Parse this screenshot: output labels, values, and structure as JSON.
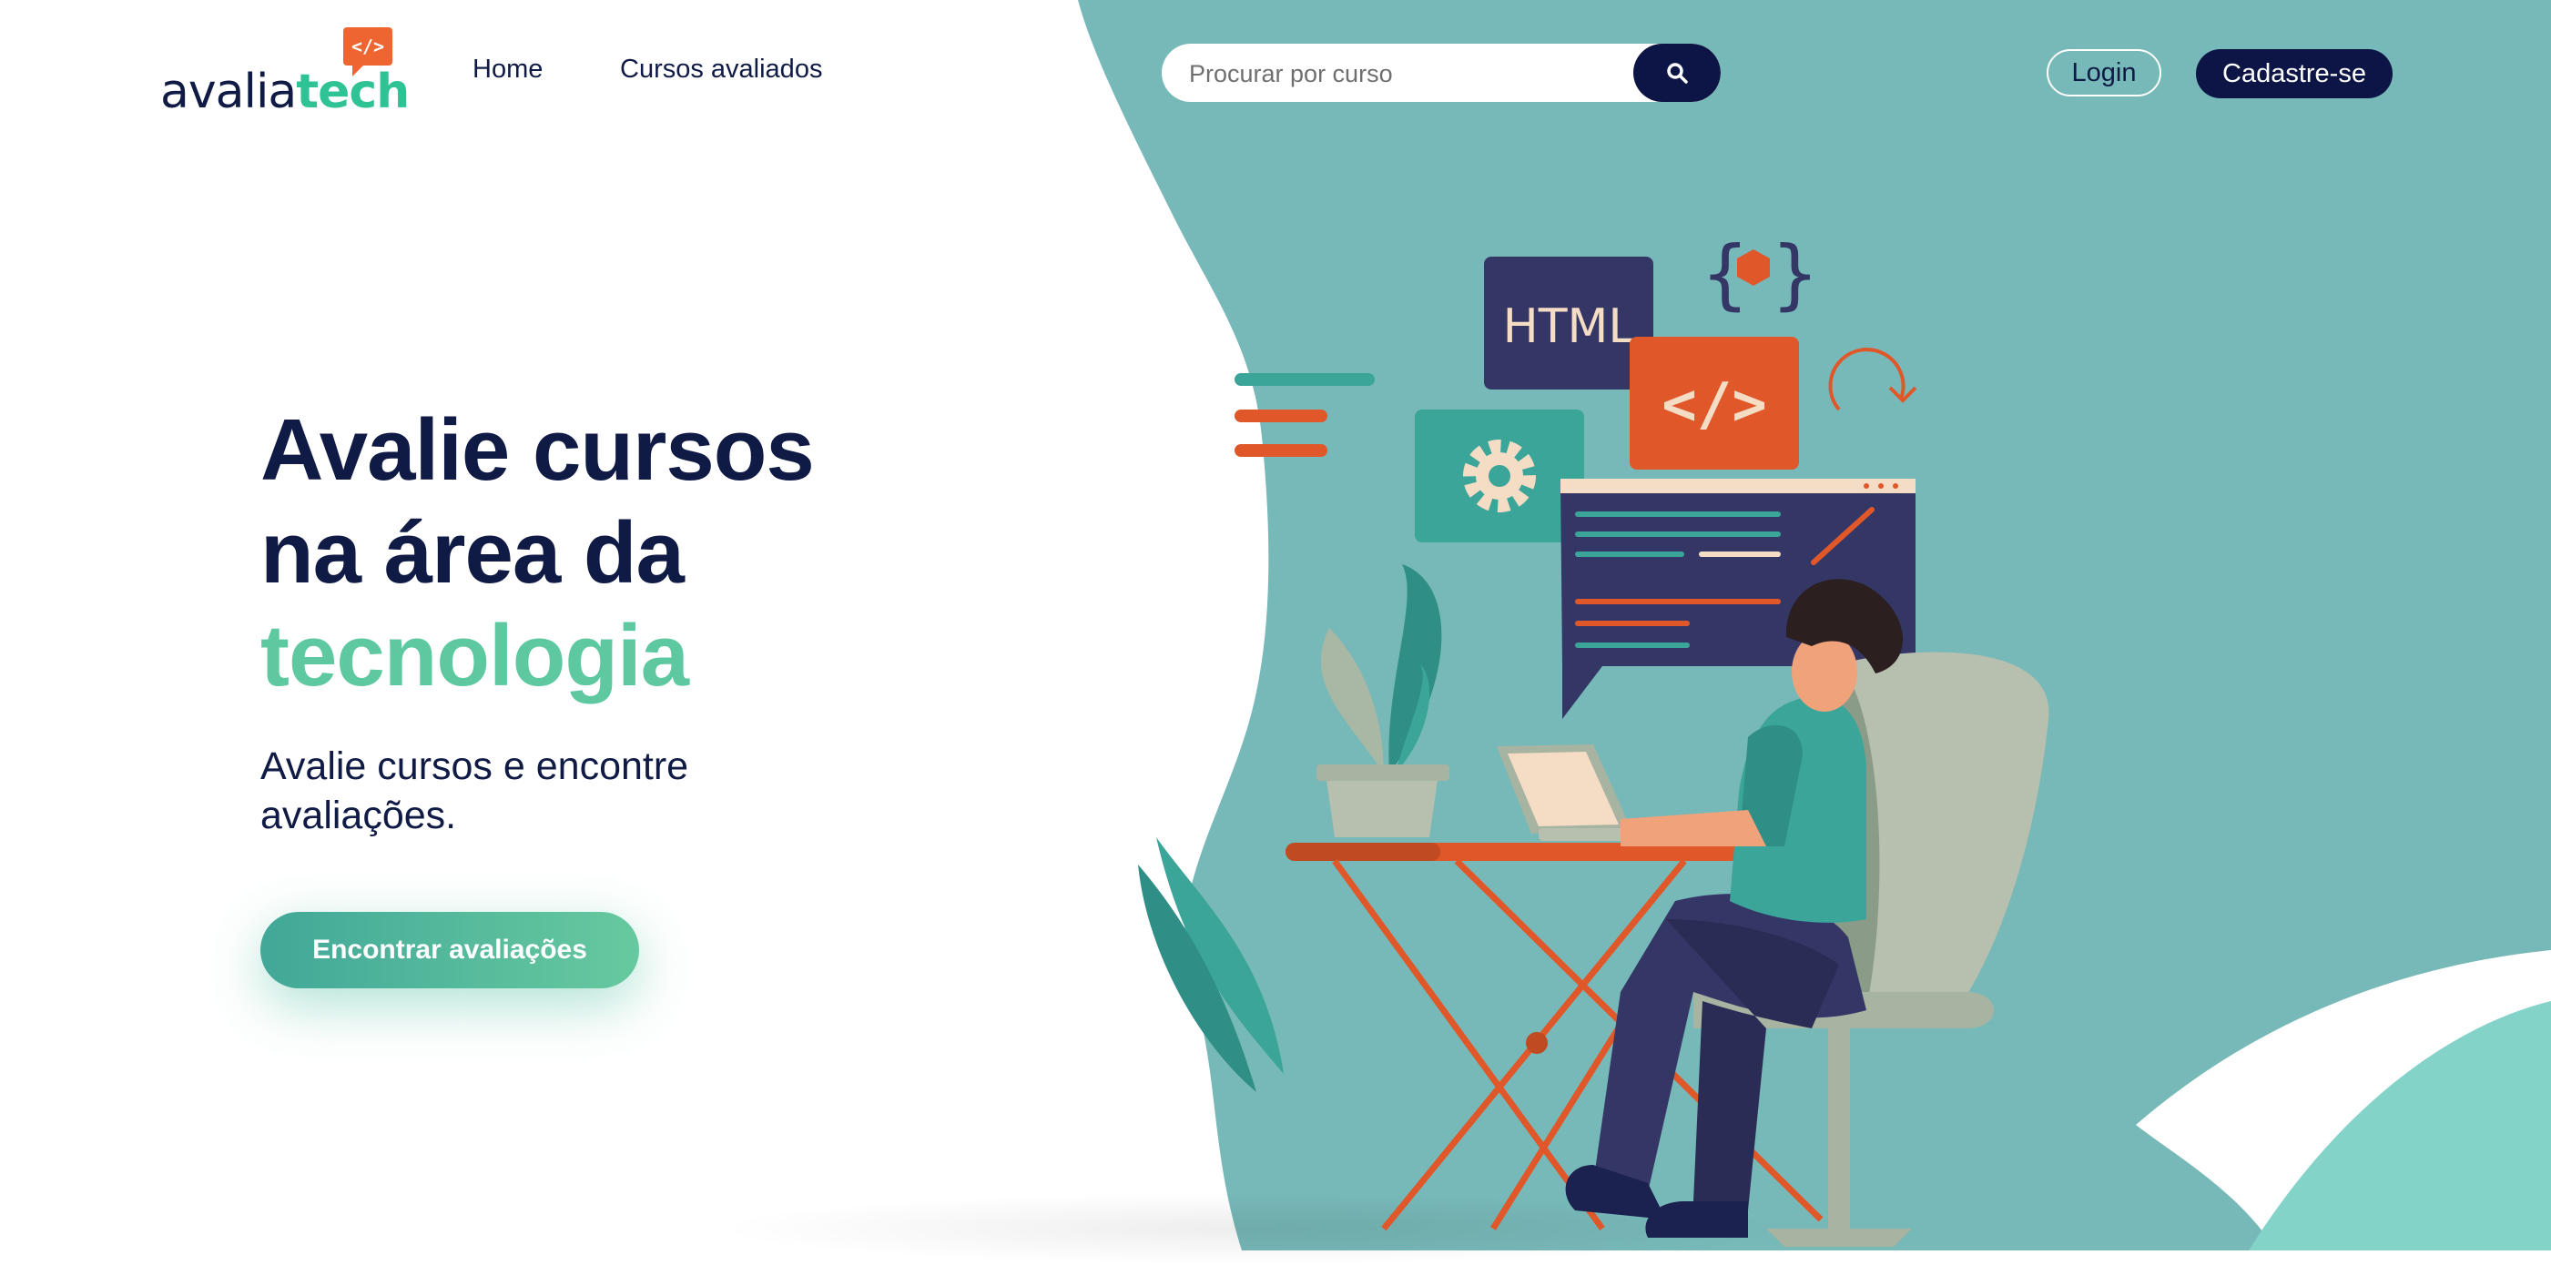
{
  "brand": {
    "name_part1": "avalia",
    "name_part2": "tech",
    "badge": "</>"
  },
  "nav": {
    "home": "Home",
    "cursos": "Cursos avaliados"
  },
  "search": {
    "placeholder": "Procurar por curso",
    "icon": "search-icon"
  },
  "auth": {
    "login": "Login",
    "signup": "Cadastre-se"
  },
  "hero": {
    "title_line1": "Avalie cursos",
    "title_line2": "na área da",
    "title_highlight": "tecnologia",
    "subtitle": "Avalie cursos e encontre avaliações.",
    "cta": "Encontrar avaliações"
  },
  "illustration": {
    "html_label": "HTML",
    "code_label": "</>"
  },
  "colors": {
    "navy": "#0f1a45",
    "teal_bg": "#77b8b8",
    "accent_green": "#5ec8a0",
    "orange": "#e0582a"
  }
}
